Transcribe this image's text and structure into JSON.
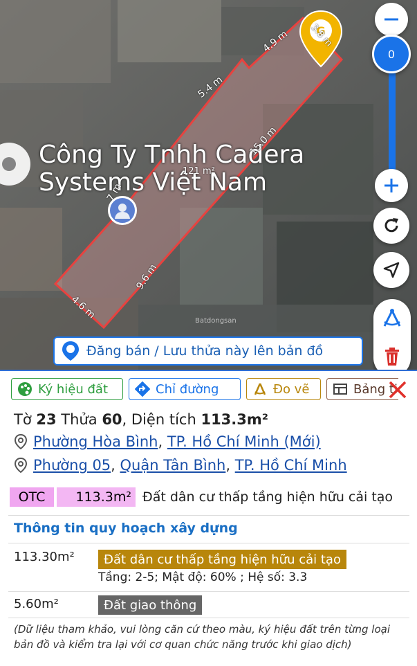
{
  "map": {
    "poi_name_line1": "Công Ty Tnhh Cadera",
    "poi_name_line2": "Systems Việt Nam",
    "area_label": "121 m²",
    "edge_labels": [
      "3.8 m",
      "4.9 m",
      "5.4 m",
      "15.0 m",
      "9.6 m",
      "4.6 m",
      "7 m"
    ],
    "watermark": "Batdongsan",
    "parcel_color": "#e8423f",
    "zoom_level": "0",
    "post_banner_label": "Đăng bán / Lưu thửa này lên bản đồ"
  },
  "tabs": [
    {
      "label": "Ký hiệu đất",
      "icon": "palette-icon",
      "color": "#2e9e3f"
    },
    {
      "label": "Chỉ đường",
      "icon": "directions-icon",
      "color": "#1a73e8"
    },
    {
      "label": "Đo vẽ",
      "icon": "measure-icon",
      "color": "#b8860b"
    },
    {
      "label": "Bảng tin",
      "icon": "table-icon",
      "color": "#8a5a44"
    }
  ],
  "parcel": {
    "sheet_label": "Tờ",
    "sheet_no": "23",
    "lot_label": "Thửa",
    "lot_no": "60",
    "area_label": "Diện tích",
    "area_value": "113.3m²"
  },
  "address_new": {
    "ward": "Phường Hòa Bình",
    "city": "TP. Hồ Chí Minh (Mới)"
  },
  "address_old": {
    "ward": "Phường 05",
    "district": "Quận Tân Bình",
    "city": "TP. Hồ Chí Minh"
  },
  "land_use": {
    "code": "OTC",
    "area": "113.3m²",
    "description": "Đất dân cư thấp tầng hiện hữu cải tạo"
  },
  "planning": {
    "title": "Thông tin quy hoạch xây dựng",
    "rows": [
      {
        "area": "113.30m²",
        "tag": "Đất dân cư thấp tầng hiện hữu cải tạo",
        "tag_color": "#b8860b",
        "details": "Tầng: 2-5; Mật độ: 60% ; Hệ số: 3.3"
      },
      {
        "area": "5.60m²",
        "tag": "Đất giao thông",
        "tag_color": "#666666",
        "details": ""
      }
    ],
    "note": "(Dữ liệu tham khảo, vui lòng căn cứ theo màu, ký hiệu đất trên từng loại bản đồ và kiểm tra lại với cơ quan chức năng trước khi giao dịch)"
  }
}
